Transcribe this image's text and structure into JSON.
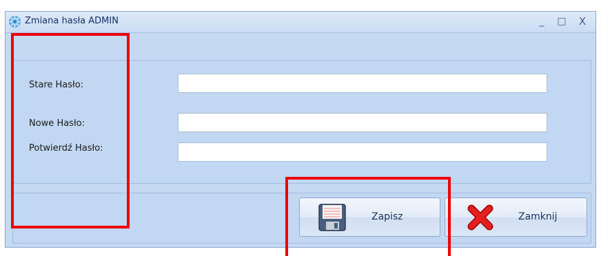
{
  "window": {
    "title": "Zmiana hasła ADMIN",
    "minimize_symbol": "_",
    "maximize_symbol": "□",
    "close_symbol": "X",
    "icon": "gear-app-icon"
  },
  "form": {
    "old_password_label": "Stare Hasło:",
    "new_password_label": "Nowe Hasło:",
    "confirm_password_label": "Potwierdź Hasło:",
    "old_password_value": "",
    "new_password_value": "",
    "confirm_password_value": ""
  },
  "actions": {
    "save_label": "Zapisz",
    "save_icon": "floppy-disk-icon",
    "close_label": "Zamknij",
    "close_icon": "red-x-icon"
  },
  "colors": {
    "window_background": "#c5d9f3",
    "title_text": "#15316b",
    "highlight": "#ec0000"
  }
}
